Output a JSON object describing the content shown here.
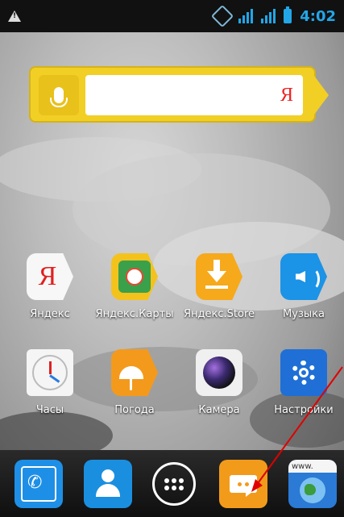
{
  "statusbar": {
    "time": "4:02"
  },
  "search_widget": {
    "logo": "Я"
  },
  "apps": [
    {
      "label": "Яндекс",
      "icon": "yandex-icon"
    },
    {
      "label": "Яндекс.Карты",
      "icon": "yandex-maps-icon"
    },
    {
      "label": "Яндекс.Store",
      "icon": "yandex-store-icon"
    },
    {
      "label": "Музыка",
      "icon": "music-icon"
    },
    {
      "label": "Часы",
      "icon": "clock-icon"
    },
    {
      "label": "Погода",
      "icon": "weather-icon"
    },
    {
      "label": "Камера",
      "icon": "camera-icon"
    },
    {
      "label": "Настройки",
      "icon": "settings-icon"
    }
  ],
  "dock": {
    "browser_bar": "www."
  },
  "colors": {
    "yandex_yellow": "#f2cf24",
    "accent_blue": "#22a6e8",
    "annotation_red": "#e00000"
  }
}
